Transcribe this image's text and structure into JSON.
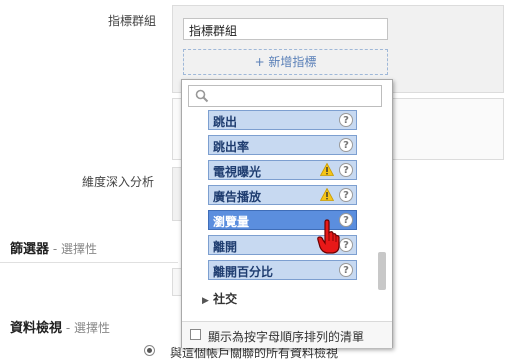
{
  "form": {
    "metric_group_label": "指標群組",
    "metric_group_value": "指標群組",
    "add_metric_label": "+ 新增指標",
    "drilldown_label": "維度深入分析"
  },
  "filters": {
    "title": "篩選器",
    "optional": "- 選擇性"
  },
  "views": {
    "title": "資料檢視",
    "optional": "- 選擇性",
    "radio_text": "與這個帳戶關聯的所有資料檢視"
  },
  "dropdown": {
    "search_placeholder": "",
    "items": [
      {
        "label": "跳出",
        "warning": false,
        "selected": false
      },
      {
        "label": "跳出率",
        "warning": false,
        "selected": false
      },
      {
        "label": "電視曝光",
        "warning": true,
        "selected": false
      },
      {
        "label": "廣告播放",
        "warning": true,
        "selected": false
      },
      {
        "label": "瀏覽量",
        "warning": false,
        "selected": true
      },
      {
        "label": "離開",
        "warning": false,
        "selected": false
      },
      {
        "label": "離開百分比",
        "warning": false,
        "selected": false
      }
    ],
    "category": "社交",
    "help_glyph": "?",
    "footer_checkbox_label": "顯示為按字母順序排列的清單",
    "colors": {
      "item_bg": "#c7d9f1",
      "item_selected_bg": "#5b8ede",
      "warning": "#f5c518"
    }
  }
}
